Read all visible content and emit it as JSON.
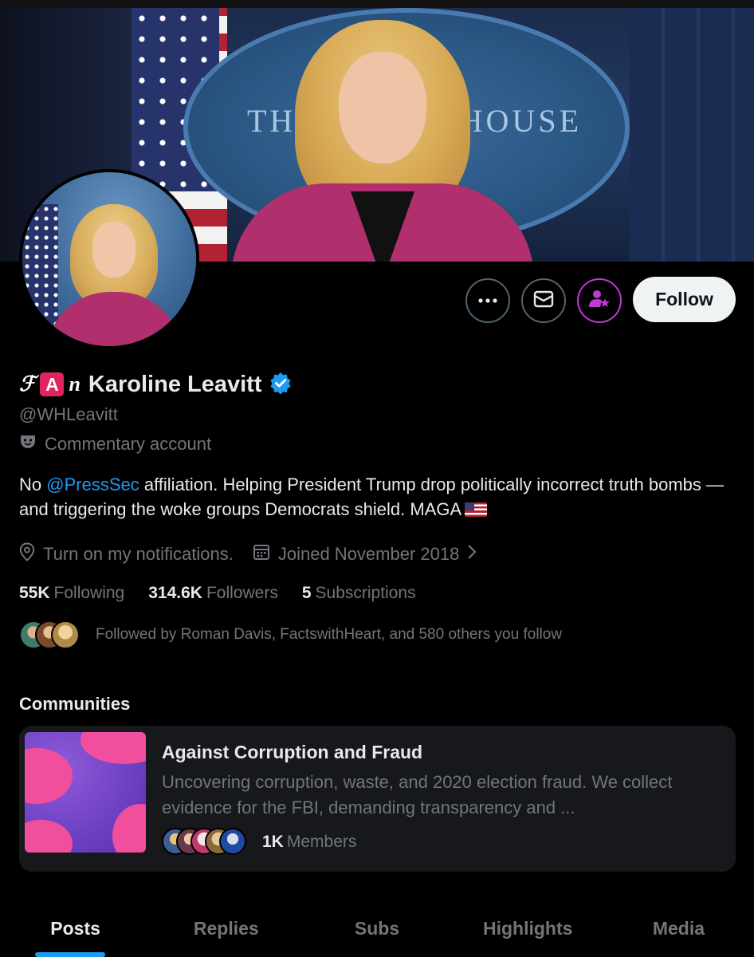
{
  "banner": {
    "seal_text_left": "TH",
    "seal_text_right": "HOUSE"
  },
  "actions": {
    "more_icon": "ellipsis-icon",
    "message_icon": "envelope-icon",
    "subscribe_icon": "subscribe-star-icon",
    "follow_label": "Follow"
  },
  "profile": {
    "name_prefix_glyph_1": "ℱ",
    "name_prefix_badge": "A",
    "name_prefix_glyph_2": "n",
    "name": "Karoline Leavitt",
    "handle": "@WHLeavitt",
    "label": "Commentary account",
    "bio_before": "No ",
    "bio_mention": "@PressSec",
    "bio_after": " affiliation. Helping President Trump drop politically incorrect truth bombs — and triggering the woke groups Democrats shield. MAGA",
    "location": "Turn on my notifications.",
    "joined": "Joined November 2018",
    "following_count": "55K",
    "following_label": "Following",
    "followers_count": "314.6K",
    "followers_label": "Followers",
    "subscriptions_count": "5",
    "subscriptions_label": "Subscriptions",
    "followed_by": "Followed by Roman Davis, FactswithHeart, and 580 others you follow"
  },
  "communities": {
    "title": "Communities",
    "items": [
      {
        "name": "Against Corruption and Fraud",
        "description": "Uncovering corruption, waste, and 2020 election fraud. We collect evidence for the FBI, demanding transparency and ...",
        "members_count": "1K",
        "members_label": "Members"
      }
    ]
  },
  "tabs": [
    {
      "label": "Posts",
      "active": true
    },
    {
      "label": "Replies"
    },
    {
      "label": "Subs"
    },
    {
      "label": "Highlights"
    },
    {
      "label": "Media"
    }
  ],
  "colors": {
    "accent": "#1d9bf0",
    "background": "#000000",
    "muted": "#71767b",
    "subscribe": "#c03ad6"
  }
}
